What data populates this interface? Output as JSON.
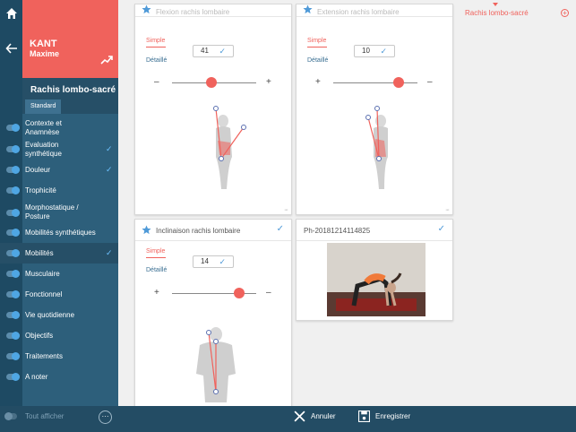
{
  "patient": {
    "last_name": "KANT",
    "first_name": "Maxime"
  },
  "section": {
    "title": "Rachis lombo-sacré",
    "tab": "Standard"
  },
  "menu": [
    {
      "label": "Contexte et Anamnèse",
      "checked": false
    },
    {
      "label": "Evaluation synthétique",
      "checked": true
    },
    {
      "label": "Douleur",
      "checked": true
    },
    {
      "label": "Trophicité",
      "checked": false
    },
    {
      "label": "Morphostatique / Posture",
      "checked": false
    },
    {
      "label": "Mobilités synthétiques",
      "checked": false
    },
    {
      "label": "Mobilités",
      "checked": true
    },
    {
      "label": "Musculaire",
      "checked": false
    },
    {
      "label": "Fonctionnel",
      "checked": false
    },
    {
      "label": "Vie quotidienne",
      "checked": false
    },
    {
      "label": "Objectifs",
      "checked": false
    },
    {
      "label": "Traitements",
      "checked": false
    },
    {
      "label": "A noter",
      "checked": false
    }
  ],
  "bottom": {
    "show_all": "Tout afficher",
    "more": "···",
    "cancel": "Annuler",
    "save": "Enregistrer"
  },
  "header": {
    "breadcrumb": "Rachis lombo-sacré"
  },
  "cards": [
    {
      "title": "Flexion rachis lombaire",
      "tab_simple": "Simple",
      "tab_detail": "Détaillé",
      "value": "41",
      "slider_fraction": 0.47
    },
    {
      "title": "Extension rachis lombaire",
      "tab_simple": "Simple",
      "tab_detail": "Détaillé",
      "value": "10",
      "slider_fraction": 0.8
    },
    {
      "title": "Inclinaison rachis lombaire",
      "tab_simple": "Simple",
      "tab_detail": "Détaillé",
      "value": "14",
      "slider_fraction": 0.78
    },
    {
      "title": "Ph-20181214114825"
    }
  ],
  "colors": {
    "accent": "#f0625c",
    "sidebar": "#2d5f7b",
    "rail": "#1e4a63",
    "check": "#4f9ad8"
  }
}
